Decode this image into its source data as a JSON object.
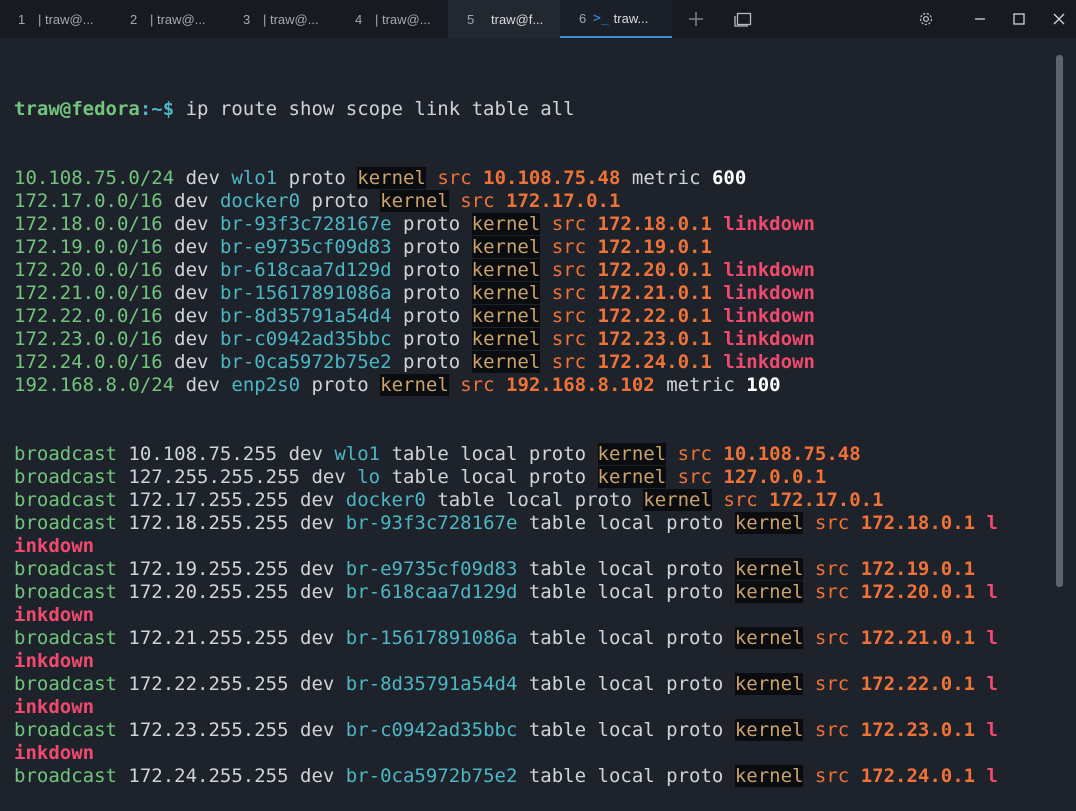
{
  "tabs": [
    {
      "num": "1",
      "label": "| traw@..."
    },
    {
      "num": "2",
      "label": "| traw@..."
    },
    {
      "num": "3",
      "label": "| traw@..."
    },
    {
      "num": "4",
      "label": "| traw@..."
    },
    {
      "num": "5",
      "label": "traw@f..."
    },
    {
      "num": "6",
      "label": "traw..."
    }
  ],
  "toolbar": {
    "new_tab_icon": "plus-icon",
    "tab_overview_icon": "window-icon",
    "settings_icon": "gear-icon",
    "minimize_icon": "minimize-icon",
    "maximize_icon": "maximize-icon",
    "close_icon": "close-icon"
  },
  "terminal": {
    "prompt_user": "traw@fedora",
    "prompt_rest": ":~$ ",
    "command": "ip route show scope link table all",
    "routes": [
      {
        "net": "10.108.75.0/24",
        "dev": "wlo1",
        "src": "10.108.75.48",
        "metric": "600",
        "linkdown": ""
      },
      {
        "net": "172.17.0.0/16",
        "dev": "docker0",
        "src": "172.17.0.1",
        "metric": "",
        "linkdown": ""
      },
      {
        "net": "172.18.0.0/16",
        "dev": "br-93f3c728167e",
        "src": "172.18.0.1",
        "metric": "",
        "linkdown": "linkdown"
      },
      {
        "net": "172.19.0.0/16",
        "dev": "br-e9735cf09d83",
        "src": "172.19.0.1",
        "metric": "",
        "linkdown": ""
      },
      {
        "net": "172.20.0.0/16",
        "dev": "br-618caa7d129d",
        "src": "172.20.0.1",
        "metric": "",
        "linkdown": "linkdown"
      },
      {
        "net": "172.21.0.0/16",
        "dev": "br-15617891086a",
        "src": "172.21.0.1",
        "metric": "",
        "linkdown": "linkdown"
      },
      {
        "net": "172.22.0.0/16",
        "dev": "br-8d35791a54d4",
        "src": "172.22.0.1",
        "metric": "",
        "linkdown": "linkdown"
      },
      {
        "net": "172.23.0.0/16",
        "dev": "br-c0942ad35bbc",
        "src": "172.23.0.1",
        "metric": "",
        "linkdown": "linkdown"
      },
      {
        "net": "172.24.0.0/16",
        "dev": "br-0ca5972b75e2",
        "src": "172.24.0.1",
        "metric": "",
        "linkdown": "linkdown"
      },
      {
        "net": "192.168.8.0/24",
        "dev": "enp2s0",
        "src": "192.168.8.102",
        "metric": "100",
        "linkdown": ""
      }
    ],
    "broadcasts": [
      {
        "addr": "10.108.75.255",
        "dev": "wlo1",
        "src": "10.108.75.48",
        "tail1": "",
        "tail2": ""
      },
      {
        "addr": "127.255.255.255",
        "dev": "lo",
        "src": "127.0.0.1",
        "tail1": "",
        "tail2": ""
      },
      {
        "addr": "172.17.255.255",
        "dev": "docker0",
        "src": "172.17.0.1",
        "tail1": "",
        "tail2": ""
      },
      {
        "addr": "172.18.255.255",
        "dev": "br-93f3c728167e",
        "src": "172.18.0.1",
        "tail1": "l",
        "tail2": "inkdown"
      },
      {
        "addr": "172.19.255.255",
        "dev": "br-e9735cf09d83",
        "src": "172.19.0.1",
        "tail1": "",
        "tail2": ""
      },
      {
        "addr": "172.20.255.255",
        "dev": "br-618caa7d129d",
        "src": "172.20.0.1",
        "tail1": "l",
        "tail2": "inkdown"
      },
      {
        "addr": "172.21.255.255",
        "dev": "br-15617891086a",
        "src": "172.21.0.1",
        "tail1": "l",
        "tail2": "inkdown"
      },
      {
        "addr": "172.22.255.255",
        "dev": "br-8d35791a54d4",
        "src": "172.22.0.1",
        "tail1": "l",
        "tail2": "inkdown"
      },
      {
        "addr": "172.23.255.255",
        "dev": "br-c0942ad35bbc",
        "src": "172.23.0.1",
        "tail1": "l",
        "tail2": "inkdown"
      },
      {
        "addr": "172.24.255.255",
        "dev": "br-0ca5972b75e2",
        "src": "172.24.0.1",
        "tail1": "l",
        "tail2": ""
      }
    ],
    "words": {
      "dev": "dev",
      "proto": "proto",
      "kernel": "kernel",
      "src": "src",
      "metric": "metric",
      "broadcast": "broadcast",
      "table": "table",
      "local": "local"
    }
  },
  "colors": {
    "background": "#1e222b",
    "tabbar": "#171a21",
    "accent": "#3f8ed8",
    "green": "#72c57d",
    "cyan": "#4cb6c3",
    "orange": "#ef7237",
    "red": "#f04a6e"
  }
}
